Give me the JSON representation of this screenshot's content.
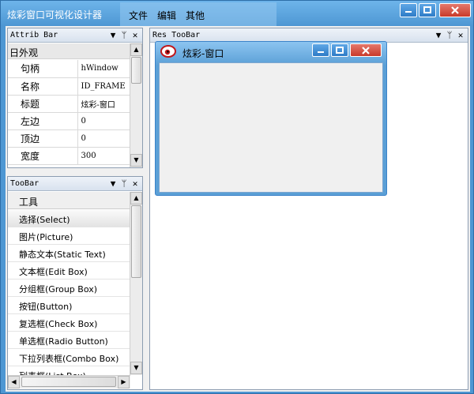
{
  "app": {
    "title": "炫彩窗口可视化设计器",
    "menu": [
      "文件",
      "编辑",
      "其他"
    ]
  },
  "attrib_bar": {
    "title": "Attrib Bar",
    "group": "日外观",
    "properties": [
      {
        "key": "句柄",
        "value": "hWindow"
      },
      {
        "key": "名称",
        "value": "ID_FRAME"
      },
      {
        "key": "标题",
        "value": "炫彩-窗口"
      },
      {
        "key": "左边",
        "value": "0"
      },
      {
        "key": "顶边",
        "value": "0"
      },
      {
        "key": "宽度",
        "value": "300"
      }
    ]
  },
  "toobar": {
    "title": "TooBar",
    "header": "工具",
    "items": [
      "选择(Select)",
      "图片(Picture)",
      "静态文本(Static Text)",
      "文本框(Edit Box)",
      "分组框(Group Box)",
      "按钮(Button)",
      "复选框(Check Box)",
      "单选框(Radio Button)",
      "下拉列表框(Combo Box)",
      "列表框(List Box)"
    ],
    "selected_index": 0
  },
  "res_toobar": {
    "title": "Res TooBar",
    "window_title": "炫彩-窗口"
  },
  "panel_icons": {
    "dropdown": "▼",
    "pin": "ᛘ",
    "close": "✕"
  },
  "colors": {
    "frame": "#4e97d3",
    "close_button": "#c93a2a"
  }
}
